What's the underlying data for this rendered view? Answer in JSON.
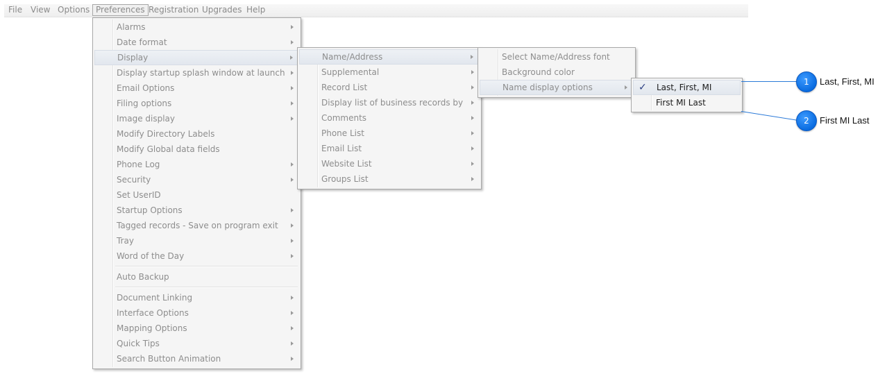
{
  "menubar": {
    "items": [
      "File",
      "View",
      "Options",
      "Preferences",
      "Registration",
      "Upgrades",
      "Help"
    ]
  },
  "preferences_menu": {
    "items": [
      "Alarms",
      "Date format",
      "Display",
      "Display startup splash window at launch",
      "Email Options",
      "Filing options",
      "Image display",
      "Modify Directory Labels",
      "Modify Global data fields",
      "Phone Log",
      "Security",
      "Set UserID",
      "Startup Options",
      "Tagged records - Save on program exit",
      "Tray",
      "Word of the Day",
      "Auto Backup",
      "Document Linking",
      "Interface Options",
      "Mapping Options",
      "Quick Tips",
      "Search Button Animation"
    ]
  },
  "display_menu": {
    "items": [
      "Name/Address",
      "Supplemental",
      "Record List",
      "Display list of business records by",
      "Comments",
      "Phone List",
      "Email List",
      "Website List",
      "Groups List"
    ]
  },
  "name_address_menu": {
    "items": [
      "Select Name/Address font",
      "Background color",
      "Name display options"
    ]
  },
  "name_display_menu": {
    "items": [
      "Last, First, MI",
      "First MI Last"
    ],
    "check_glyph": "✓"
  },
  "callouts": [
    {
      "number": "1",
      "text": "Last, First, MI"
    },
    {
      "number": "2",
      "text": "First MI Last"
    }
  ],
  "colors": {
    "accent": "#0a6ce0",
    "callout_line": "#2b7ad8"
  }
}
